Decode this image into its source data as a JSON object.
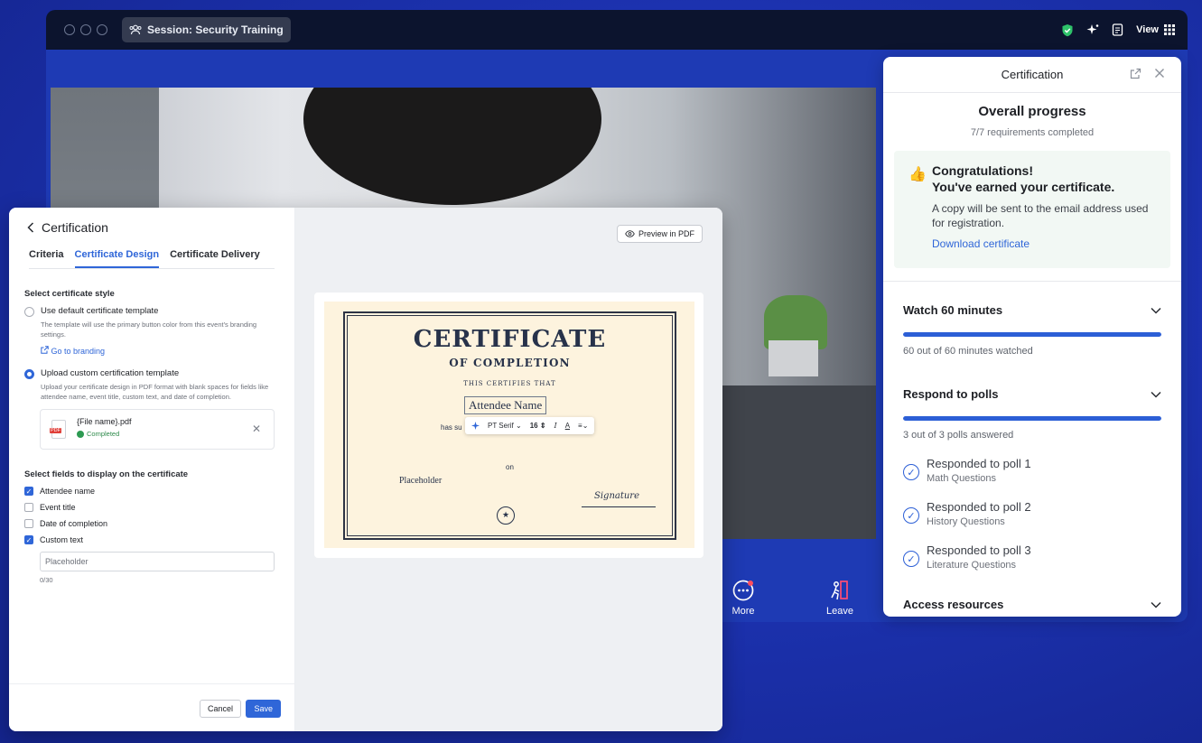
{
  "topbar": {
    "session_title": "Session: Security Training",
    "view_label": "View"
  },
  "controls": {
    "more_label": "More",
    "leave_label": "Leave"
  },
  "right_panel": {
    "title": "Certification",
    "overall_title": "Overall progress",
    "overall_sub": "7/7 requirements completed",
    "congrats": {
      "line1": "Congratulations!",
      "line2": "You've earned your certificate.",
      "body": "A copy will be sent to the email address used for registration.",
      "link": "Download certificate"
    },
    "requirements": [
      {
        "title": "Watch 60 minutes",
        "progress": 1.0,
        "sub": "60 out of 60 minutes watched"
      },
      {
        "title": "Respond to polls",
        "progress": 1.0,
        "sub": "3 out of 3 polls answered"
      }
    ],
    "polls": [
      {
        "title": "Responded to poll 1",
        "sub": "Math Questions"
      },
      {
        "title": "Responded to poll 2",
        "sub": "History Questions"
      },
      {
        "title": "Responded to poll 3",
        "sub": "Literature Questions"
      }
    ],
    "next_section": "Access resources"
  },
  "left_panel": {
    "title": "Certification",
    "tabs": [
      "Criteria",
      "Certificate Design",
      "Certificate Delivery"
    ],
    "active_tab": 1,
    "style_section": "Select certificate style",
    "opt_default": "Use default certificate template",
    "opt_default_hint": "The template will use the primary button color from this event's branding settings.",
    "branding_link": "Go to branding",
    "opt_custom": "Upload custom certification template",
    "opt_custom_hint": "Upload your certificate design in PDF format with blank spaces for fields like attendee name, event title, custom text, and date of completion.",
    "file_name": "{File name}.pdf",
    "file_badge": "PDF",
    "file_status": "Completed",
    "fields_section": "Select fields to display on the certificate",
    "fields": [
      {
        "label": "Attendee name",
        "checked": true
      },
      {
        "label": "Event title",
        "checked": false
      },
      {
        "label": "Date of completion",
        "checked": false
      },
      {
        "label": "Custom text",
        "checked": true
      }
    ],
    "custom_text_placeholder": "Placeholder",
    "counter": "0/30",
    "cancel": "Cancel",
    "save": "Save",
    "preview_btn": "Preview in PDF"
  },
  "certificate": {
    "title": "CERTIFICATE",
    "subtitle": "OF COMPLETION",
    "certifies": "THIS CERTIFIES THAT",
    "name": "Attendee Name",
    "has": "has su",
    "toolbar_font": "PT Serif",
    "toolbar_size": "16",
    "on": "on",
    "placeholder": "Placeholder",
    "signature": "Signature"
  },
  "colors": {
    "accent": "#2f66d8",
    "success": "#2d9a52",
    "background": "#1c32b0"
  }
}
